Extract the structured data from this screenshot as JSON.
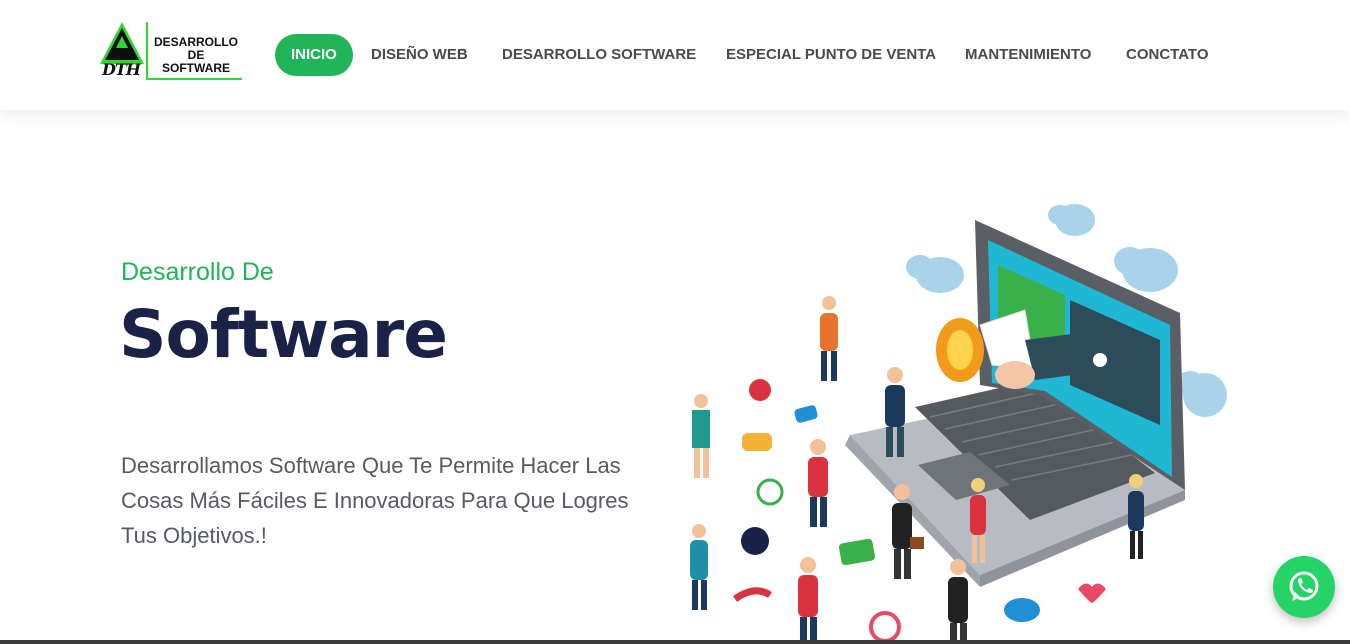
{
  "logo": {
    "mark_text": "DTH",
    "text_lines": [
      "DESARROLLO",
      "DE",
      "SOFTWARE"
    ]
  },
  "nav": {
    "items": [
      {
        "label": "INICIO",
        "active": true
      },
      {
        "label": "DISEÑO WEB"
      },
      {
        "label": "DESARROLLO SOFTWARE"
      },
      {
        "label": "ESPECIAL PUNTO DE VENTA"
      },
      {
        "label": "MANTENIMIENTO"
      },
      {
        "label": "CONCTATO"
      }
    ]
  },
  "hero": {
    "subtitle": "Desarrollo De",
    "title": "Software",
    "description": "Desarrollamos Software Que Te Permite Hacer Las Cosas Más Fáciles E Innovadoras Para Que Logres Tus Objetivos.!"
  },
  "illustration": {
    "icon": "laptop-megaphone-people-illustration"
  },
  "whatsapp": {
    "icon": "whatsapp-icon"
  },
  "colors": {
    "accent": "#22b458",
    "title": "#1b2247",
    "text": "#555a64",
    "logo_green": "#33d633",
    "whatsapp": "#25d366"
  }
}
